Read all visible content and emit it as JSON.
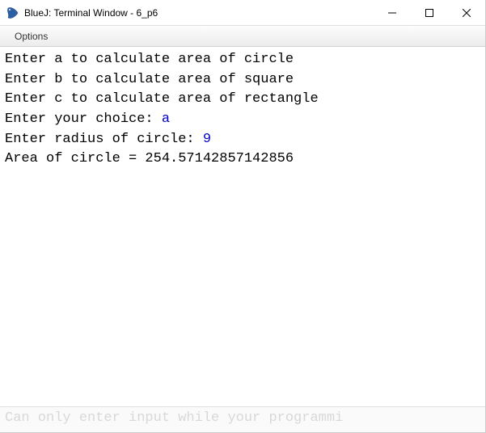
{
  "window": {
    "title": "BlueJ: Terminal Window - 6_p6"
  },
  "menu": {
    "options": "Options"
  },
  "terminal": {
    "lines": [
      {
        "prompt": "Enter a to calculate area of circle",
        "input": ""
      },
      {
        "prompt": "Enter b to calculate area of square",
        "input": ""
      },
      {
        "prompt": "Enter c to calculate area of rectangle",
        "input": ""
      },
      {
        "prompt": "Enter your choice: ",
        "input": "a"
      },
      {
        "prompt": "Enter radius of circle: ",
        "input": "9"
      },
      {
        "prompt": "Area of circle = 254.57142857142856",
        "input": ""
      }
    ]
  },
  "status": {
    "text": "Can only enter input while your programmi"
  }
}
